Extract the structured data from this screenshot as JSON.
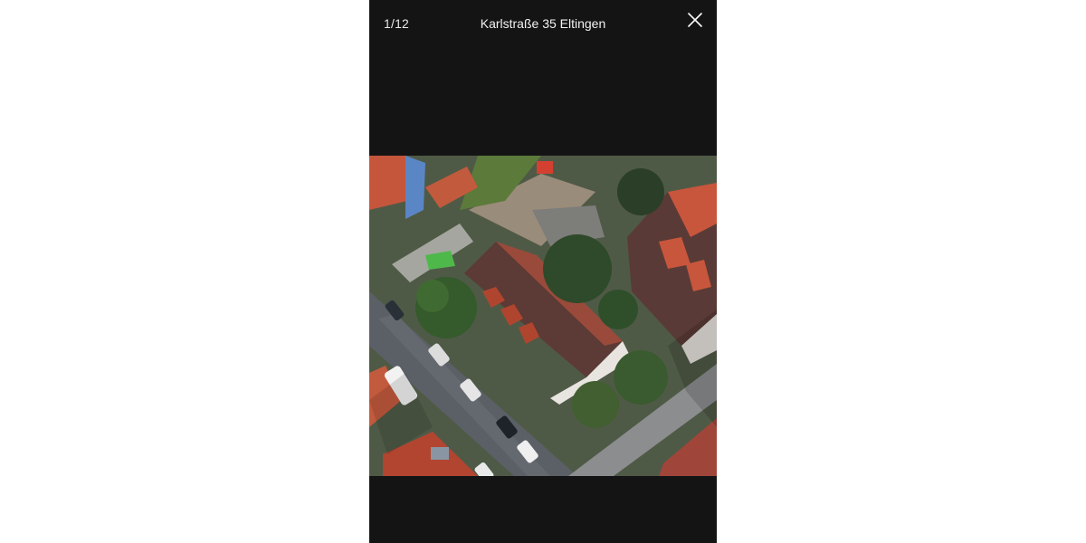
{
  "viewer": {
    "counter": "1/12",
    "title": "Karlstraße 35 Eltingen",
    "close_icon": "close-icon",
    "photo": {
      "kind": "aerial-photo",
      "description_icon": "aerial-map-image"
    }
  },
  "colors": {
    "viewer_background": "#141415",
    "page_background": "#ffffff",
    "text": "#ffffff"
  }
}
